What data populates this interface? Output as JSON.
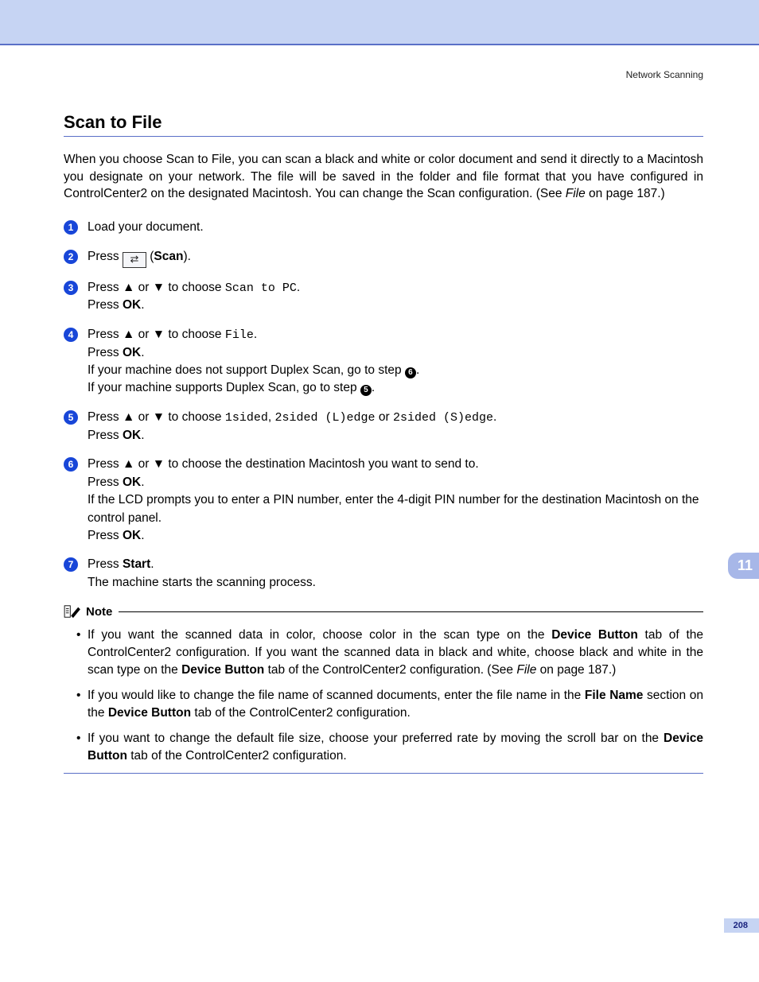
{
  "header": {
    "section": "Network Scanning"
  },
  "title": "Scan to File",
  "intro": {
    "pre": "When you choose Scan to File, you can scan a black and white or color document and send it directly to a Macintosh you designate on your network. The file will be saved in the folder and file format that you have configured in ControlCenter2 on the designated Macintosh. You can change the Scan configuration. (See ",
    "link": "File",
    "post": " on page 187.)"
  },
  "steps": {
    "s1": "Load your document.",
    "s2": {
      "pre": "Press ",
      "label": "Scan",
      "post": ")."
    },
    "s3": {
      "pre": "Press ",
      "up": "▲",
      "mid1": " or ",
      "down": "▼",
      "mid2": " to choose ",
      "opt": "Scan to PC",
      "end": ".",
      "ok": "Press ",
      "okb": "OK",
      "okend": "."
    },
    "s4": {
      "pre": "Press ",
      "up": "▲",
      "mid1": " or ",
      "down": "▼",
      "mid2": " to choose ",
      "opt": "File",
      "end": ".",
      "ok": "Press ",
      "okb": "OK",
      "okend": ".",
      "no_dup": "If your machine does not support Duplex Scan, go to step ",
      "no_dup_n": "6",
      "no_dup_end": ".",
      "dup": "If your machine supports Duplex Scan, go to step ",
      "dup_n": "5",
      "dup_end": "."
    },
    "s5": {
      "pre": "Press ",
      "up": "▲",
      "mid1": " or ",
      "down": "▼",
      "mid2": " to choose ",
      "o1": "1sided",
      "c1": ", ",
      "o2": "2sided (L)edge",
      "c2": " or ",
      "o3": "2sided (S)edge",
      "end": ".",
      "ok": "Press ",
      "okb": "OK",
      "okend": "."
    },
    "s6": {
      "pre": "Press ",
      "up": "▲",
      "mid1": " or ",
      "down": "▼",
      "mid2": " to choose the destination Macintosh you want to send to.",
      "ok": "Press ",
      "okb": "OK",
      "okend": ".",
      "pin": "If the LCD prompts you to enter a PIN number, enter the 4-digit PIN number for the destination Macintosh on the control panel.",
      "ok2": "Press ",
      "ok2b": "OK",
      "ok2end": "."
    },
    "s7": {
      "pre": "Press ",
      "start": "Start",
      "end": ".",
      "msg": "The machine starts the scanning process."
    }
  },
  "sidetab": "11",
  "note": {
    "label": "Note",
    "n1": {
      "a": "If you want the scanned data in color, choose color in the scan type on the ",
      "b1": "Device Button",
      "c": " tab of the ControlCenter2 configuration. If you want the scanned data in black and white, choose black and white in the scan type on the ",
      "b2": "Device Button",
      "d": " tab of the ControlCenter2 configuration. (See ",
      "link": "File",
      "e": " on page 187.)"
    },
    "n2": {
      "a": "If you would like to change the file name of scanned documents, enter the file name in the ",
      "b1": "File Name",
      "c": " section on the ",
      "b2": "Device Button",
      "d": " tab of the ControlCenter2 configuration."
    },
    "n3": {
      "a": "If you want to change the default file size, choose your preferred rate by moving the scroll bar on the ",
      "b1": "Device Button",
      "c": " tab of the ControlCenter2 configuration."
    }
  },
  "page_num": "208"
}
